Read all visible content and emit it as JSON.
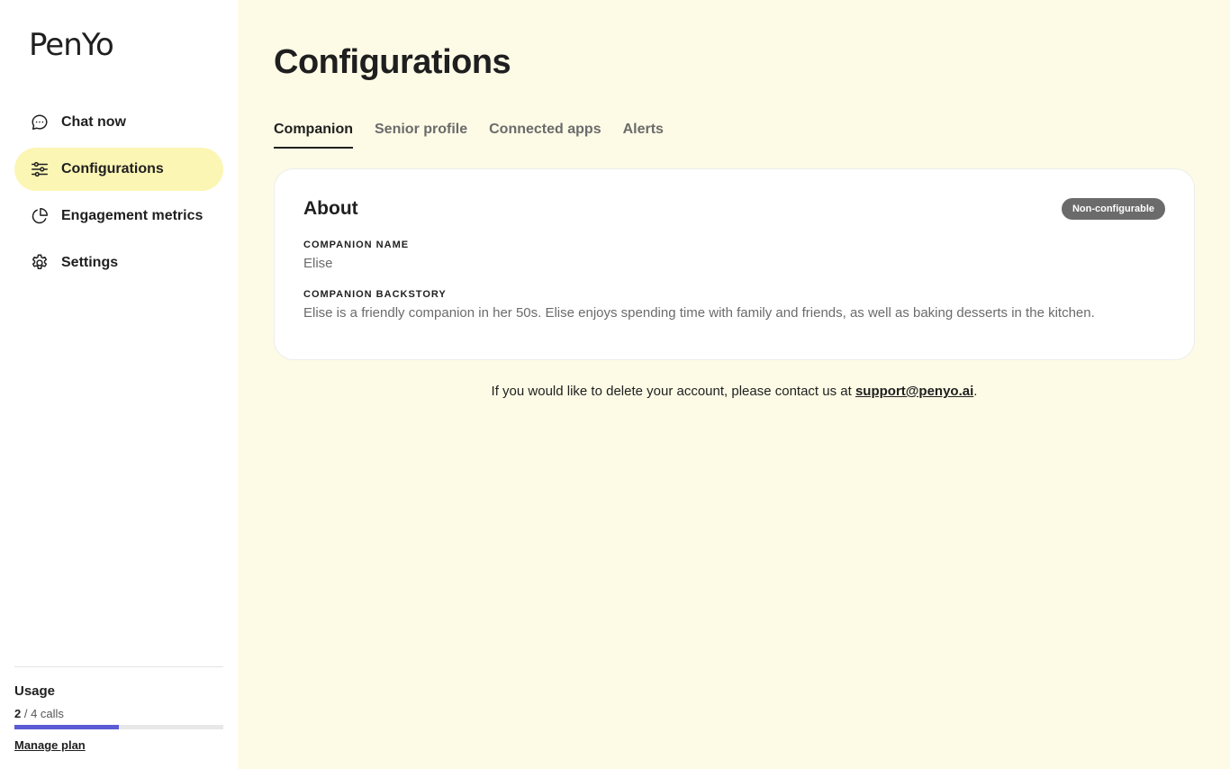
{
  "brand": {
    "logo_text": "PenYo"
  },
  "sidebar": {
    "items": [
      {
        "label": "Chat now",
        "icon": "chat-bubble-icon",
        "active": false
      },
      {
        "label": "Configurations",
        "icon": "sliders-icon",
        "active": true
      },
      {
        "label": "Engagement metrics",
        "icon": "pie-chart-icon",
        "active": false
      },
      {
        "label": "Settings",
        "icon": "gear-icon",
        "active": false
      }
    ]
  },
  "usage": {
    "title": "Usage",
    "used": "2",
    "total_text": "/ 4 calls",
    "fraction": 0.5,
    "manage_label": "Manage plan"
  },
  "main": {
    "title": "Configurations",
    "tabs": [
      {
        "label": "Companion",
        "active": true
      },
      {
        "label": "Senior profile",
        "active": false
      },
      {
        "label": "Connected apps",
        "active": false
      },
      {
        "label": "Alerts",
        "active": false
      }
    ],
    "card": {
      "title": "About",
      "badge": "Non-configurable",
      "fields": [
        {
          "label": "COMPANION NAME",
          "value": "Elise"
        },
        {
          "label": "COMPANION BACKSTORY",
          "value": "Elise is a friendly companion in her 50s. Elise enjoys spending time with family and friends, as well as baking desserts in the kitchen."
        }
      ]
    },
    "footer": {
      "text": "If you would like to delete your account, please contact us at ",
      "email": "support@penyo.ai",
      "suffix": "."
    }
  },
  "colors": {
    "background": "#fdfbe6",
    "active_nav": "#fcf6b4",
    "usage_bar": "#5b5bd6",
    "badge": "#6b6b6b"
  }
}
